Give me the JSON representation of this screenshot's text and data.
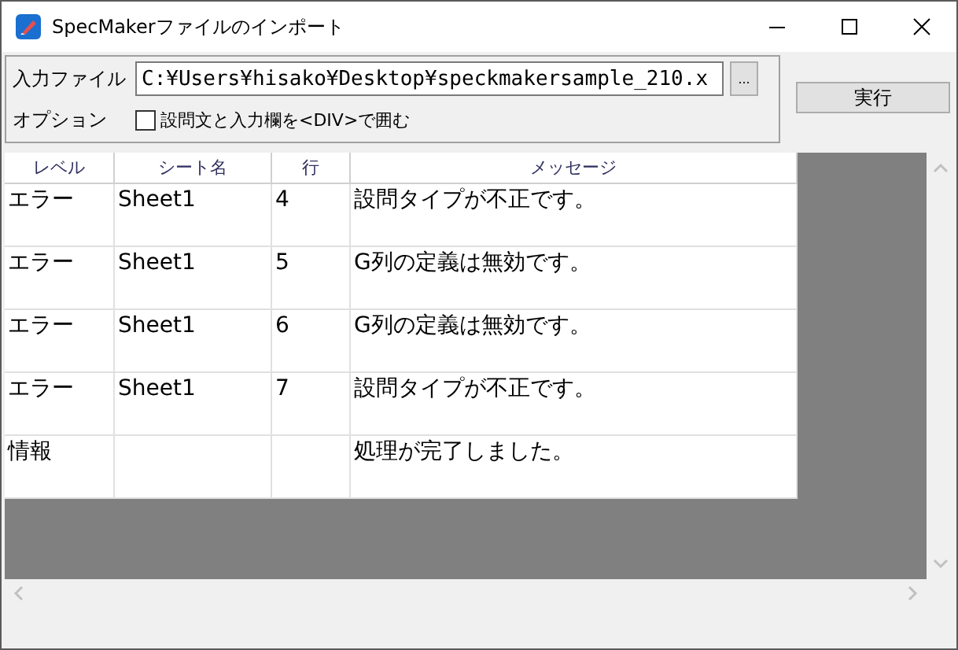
{
  "window": {
    "title": "SpecMakerファイルのインポート"
  },
  "input_file": {
    "label": "入力ファイル",
    "value": "C:¥Users¥hisako¥Desktop¥speckmakersample_210.x",
    "browse_button": "..."
  },
  "option": {
    "label": "オプション",
    "checkbox": {
      "label": "設問文と入力欄を<DIV>で囲む",
      "checked": false
    }
  },
  "run_button": "実行",
  "table": {
    "columns": [
      "レベル",
      "シート名",
      "行",
      "メッセージ"
    ],
    "rows": [
      [
        "エラー",
        "Sheet1",
        "4",
        "設問タイプが不正です。"
      ],
      [
        "エラー",
        "Sheet1",
        "5",
        "G列の定義は無効です。"
      ],
      [
        "エラー",
        "Sheet1",
        "6",
        "G列の定義は無効です。"
      ],
      [
        "エラー",
        "Sheet1",
        "7",
        "設問タイプが不正です。"
      ],
      [
        "情報",
        "",
        "",
        "処理が完了しました。"
      ]
    ]
  }
}
